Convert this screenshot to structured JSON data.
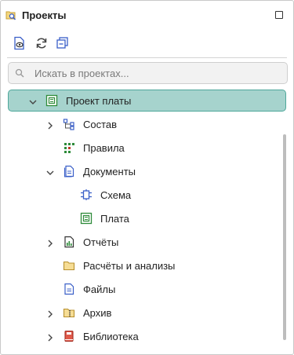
{
  "panel": {
    "title": "Проекты"
  },
  "search": {
    "placeholder": "Искать в проектах..."
  },
  "tree": {
    "root": {
      "label": "Проект платы"
    },
    "items": [
      {
        "label": "Состав"
      },
      {
        "label": "Правила"
      },
      {
        "label": "Документы"
      },
      {
        "label": "Схема"
      },
      {
        "label": "Плата"
      },
      {
        "label": "Отчёты"
      },
      {
        "label": "Расчёты и анализы"
      },
      {
        "label": "Файлы"
      },
      {
        "label": "Архив"
      },
      {
        "label": "Библиотека"
      }
    ]
  },
  "colors": {
    "selection_fill": "#a6d3cd",
    "selection_border": "#4ea79a",
    "icon_blue": "#3a5fc8",
    "icon_green": "#2e8b3a",
    "folder_yellow": "#e8c86a"
  },
  "icons": {
    "toolbar": [
      "view-icon",
      "refresh-icon",
      "collapse-all-icon"
    ]
  }
}
